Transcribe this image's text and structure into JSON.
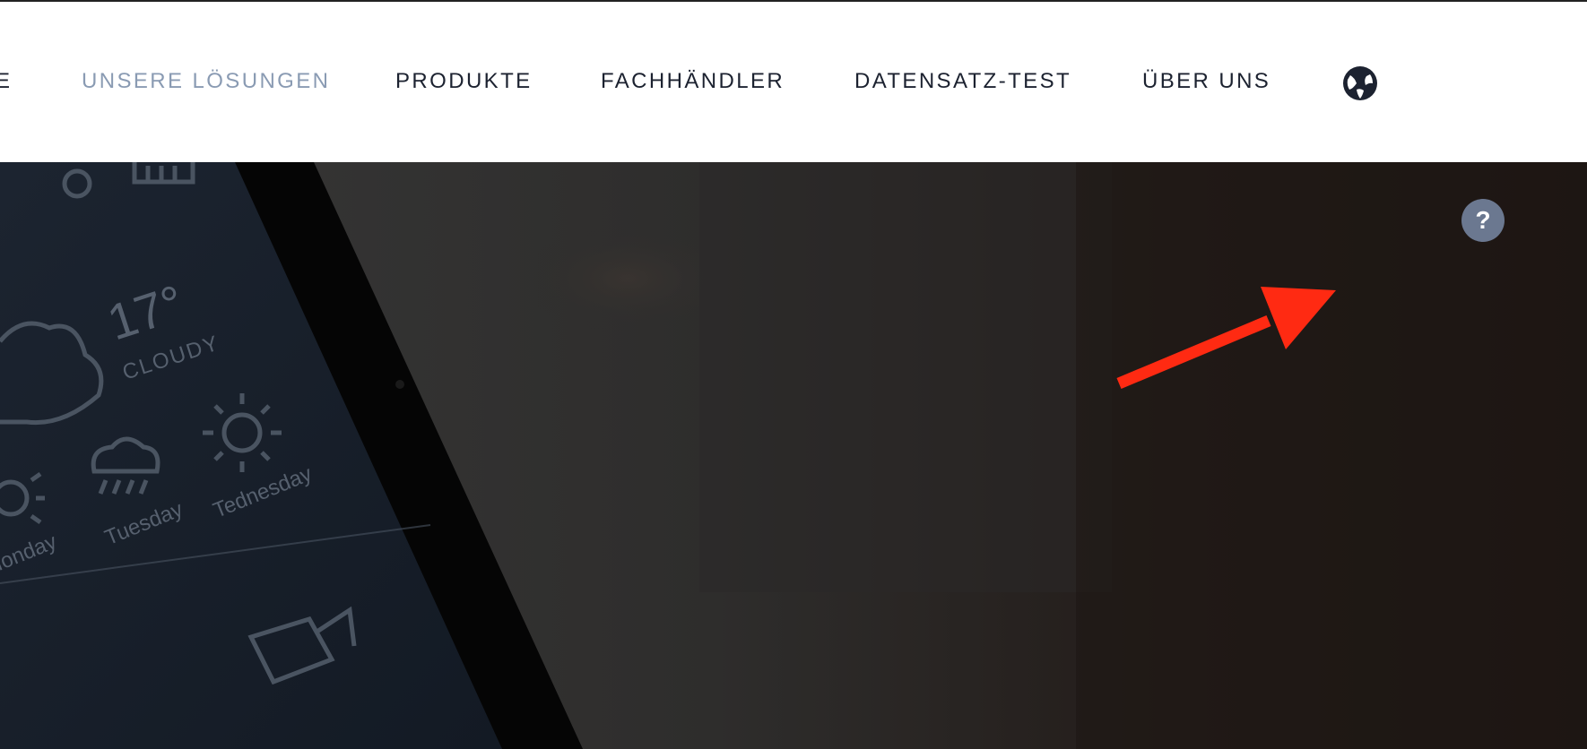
{
  "nav": {
    "items": [
      {
        "label": "E",
        "active": false
      },
      {
        "label": "UNSERE LÖSUNGEN",
        "active": true
      },
      {
        "label": "PRODUKTE",
        "active": false
      },
      {
        "label": "FACHHÄNDLER",
        "active": false
      },
      {
        "label": "DATENSATZ-TEST",
        "active": false
      },
      {
        "label": "ÜBER UNS",
        "active": false
      }
    ],
    "language_icon": "globe-icon"
  },
  "hero": {
    "weather": {
      "temperature": "17°",
      "condition": "CLOUDY",
      "days": [
        "Monday",
        "Tuesday",
        "Tednesday"
      ]
    },
    "help_label": "?",
    "annotation_color": "#ff2a12"
  },
  "colors": {
    "nav_text": "#1c2230",
    "nav_active": "#8a9bb3",
    "help_bg": "#6b7890"
  }
}
